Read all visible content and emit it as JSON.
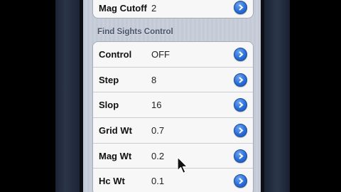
{
  "top_row": {
    "label": "Mag Cutoff",
    "value": "2"
  },
  "section": {
    "title": "Find Sights Control",
    "rows": [
      {
        "label": "Control",
        "value": "OFF"
      },
      {
        "label": "Step",
        "value": "8"
      },
      {
        "label": "Slop",
        "value": "16"
      },
      {
        "label": "Grid Wt",
        "value": "0.7"
      },
      {
        "label": "Mag Wt",
        "value": "0.2"
      },
      {
        "label": "Hc Wt",
        "value": "0.1"
      }
    ]
  },
  "icons": {
    "disclosure": "chevron-right-circle-icon",
    "cursor": "mouse-pointer-icon"
  },
  "colors": {
    "accent": "#2a6ed8",
    "background": "#c5ccd6"
  }
}
